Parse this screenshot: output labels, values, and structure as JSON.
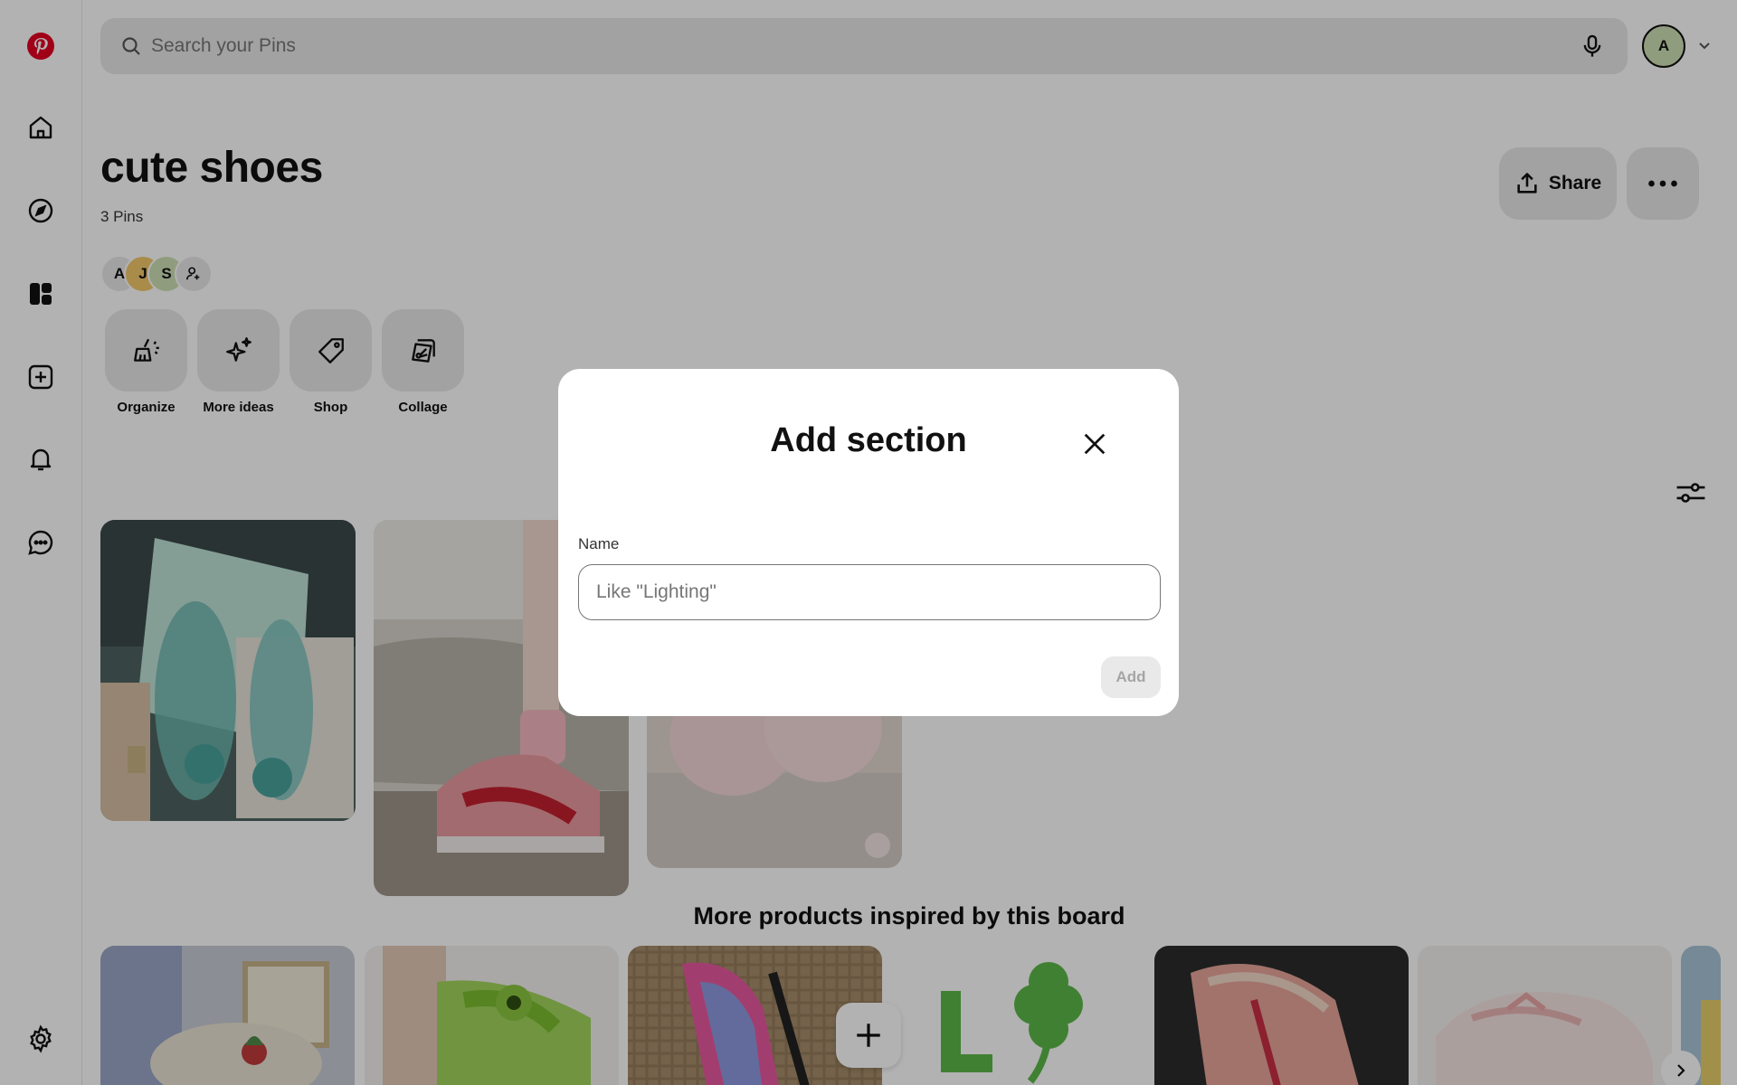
{
  "search": {
    "placeholder": "Search your Pins"
  },
  "user": {
    "initial": "A"
  },
  "board": {
    "title": "cute shoes",
    "pin_count": "3 Pins",
    "share_label": "Share",
    "collaborators": [
      {
        "initial": "A",
        "color": "#e9e9e9"
      },
      {
        "initial": "J",
        "color": "#f2c86a"
      },
      {
        "initial": "S",
        "color": "#cfe0b5"
      }
    ]
  },
  "tools": [
    {
      "label": "Organize",
      "icon": "broom-icon"
    },
    {
      "label": "More ideas",
      "icon": "sparkle-icon"
    },
    {
      "label": "Shop",
      "icon": "tag-icon"
    },
    {
      "label": "Collage",
      "icon": "collage-icon"
    }
  ],
  "sidebar": {
    "items": [
      {
        "icon": "pinterest-logo"
      },
      {
        "icon": "home-icon"
      },
      {
        "icon": "explore-icon"
      },
      {
        "icon": "boards-icon"
      },
      {
        "icon": "create-icon"
      },
      {
        "icon": "notifications-icon"
      },
      {
        "icon": "messages-icon"
      },
      {
        "icon": "settings-icon"
      }
    ]
  },
  "more_section": {
    "title": "More products inspired by this board"
  },
  "modal": {
    "title": "Add section",
    "field_label": "Name",
    "placeholder": "Like \"Lighting\"",
    "add_label": "Add"
  },
  "colors": {
    "brand": "#e60023",
    "overlay": "rgba(0,0,0,0.3)"
  }
}
